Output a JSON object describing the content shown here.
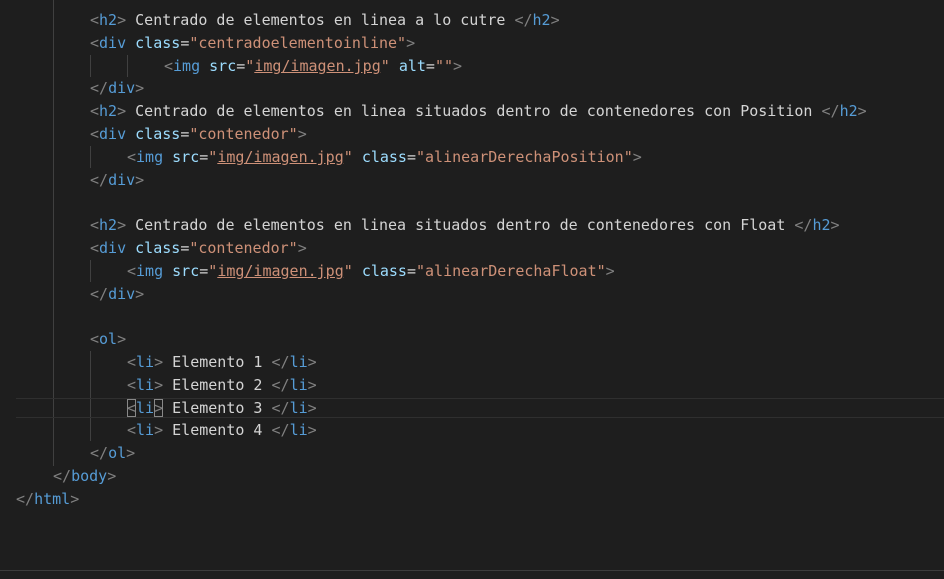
{
  "lines": [
    {
      "h2_text": " Centrado de elementos en linea a lo cutre "
    },
    {
      "class_value": "\"centradoelementoinline\""
    },
    {
      "src_value": "img/imagen.jpg",
      "alt_value": "\"\""
    },
    {},
    {
      "h2_text": " Centrado de elementos en linea situados dentro de contenedores con Position "
    },
    {
      "class_value": "\"contenedor\""
    },
    {
      "src_value": "img/imagen.jpg",
      "class_value": "\"alinearDerechaPosition\""
    },
    {},
    {},
    {
      "h2_text": " Centrado de elementos en linea situados dentro de contenedores con Float "
    },
    {
      "class_value": "\"contenedor\""
    },
    {
      "src_value": "img/imagen.jpg",
      "class_value": "\"alinearDerechaFloat\""
    },
    {},
    {},
    {},
    {
      "text": " Elemento 1 "
    },
    {
      "text": " Elemento 2 "
    },
    {
      "text": " Elemento 3 "
    },
    {
      "text": " Elemento 4 "
    },
    {},
    {},
    {}
  ],
  "tags": {
    "h2": "h2",
    "div": "div",
    "img": "img",
    "ol": "ol",
    "li": "li",
    "body": "body",
    "html": "html"
  },
  "attrs": {
    "class": "class",
    "src": "src",
    "alt": "alt"
  },
  "theme": {
    "background": "#1e1e1e",
    "tag_color": "#569cd6",
    "attr_color": "#9cdcfe",
    "string_color": "#ce9178",
    "punct_color": "#808080",
    "text_color": "#d4d4d4"
  }
}
